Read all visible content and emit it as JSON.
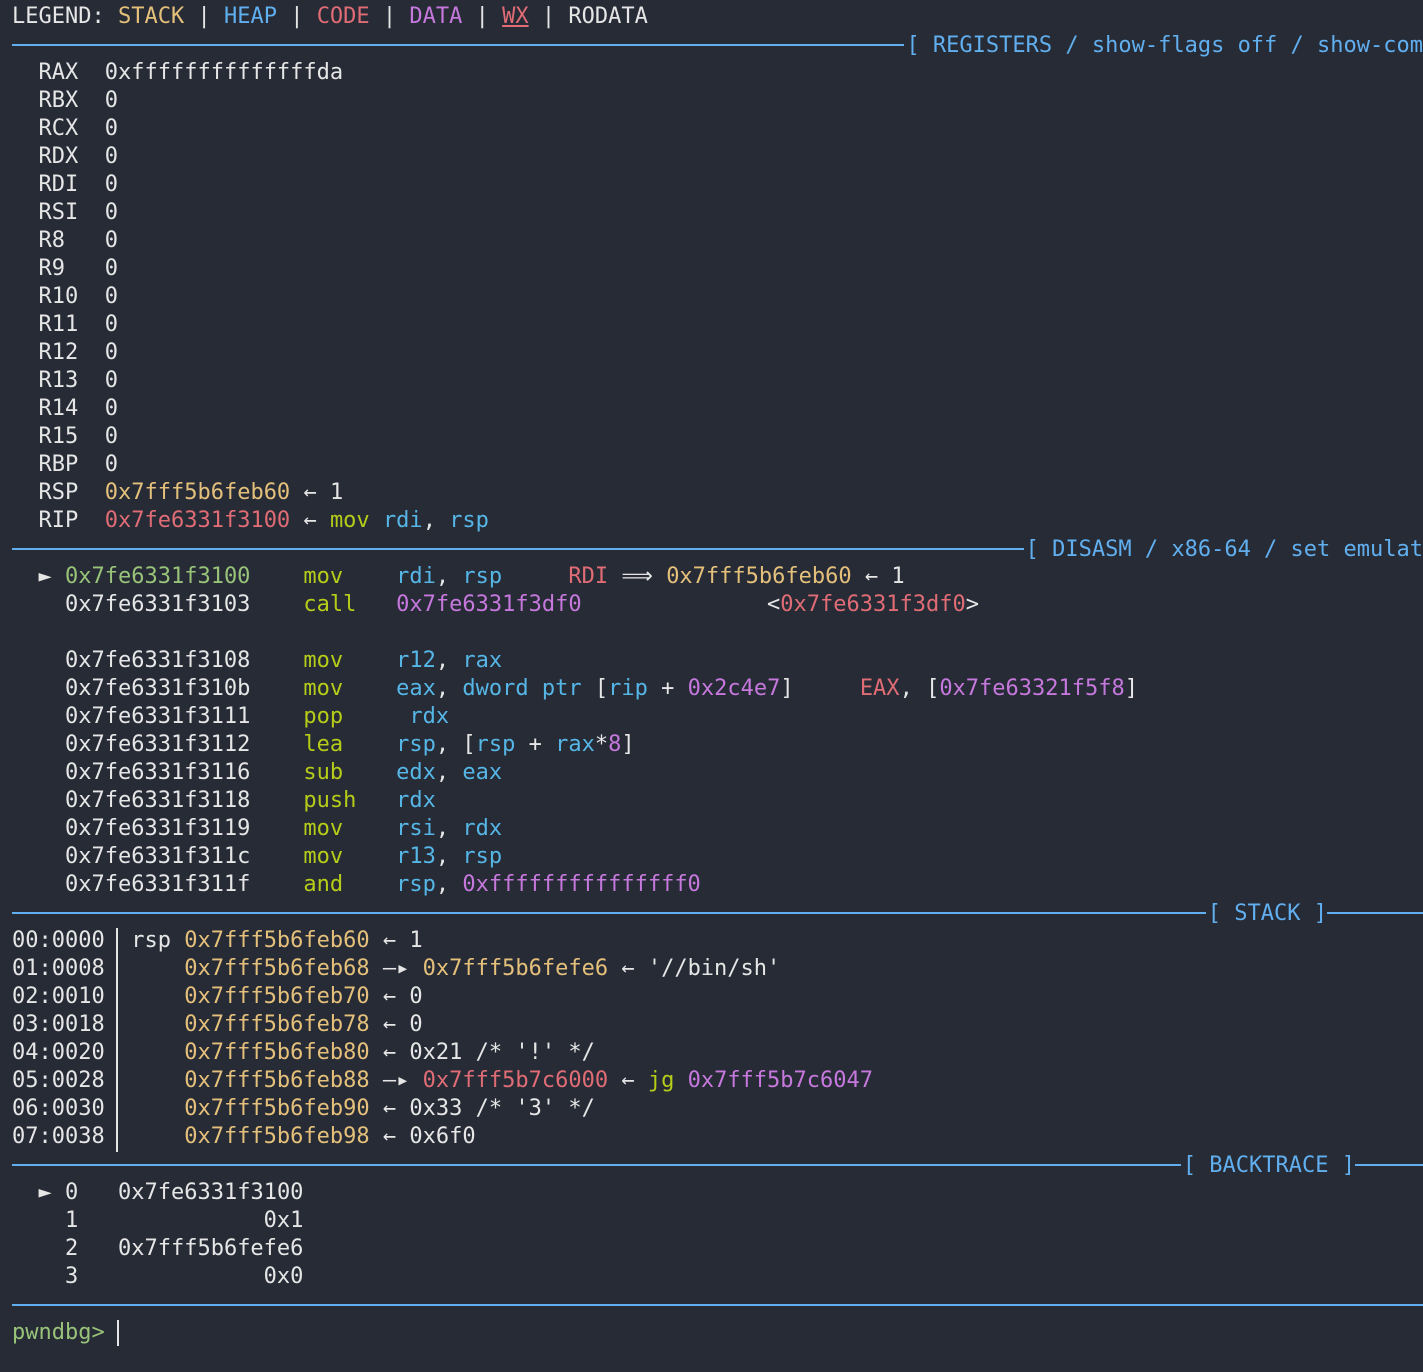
{
  "legend": {
    "label": "LEGEND:",
    "sep": "|",
    "stack": "STACK",
    "heap": "HEAP",
    "code": "CODE",
    "data": "DATA",
    "wx": "WX",
    "rodata": "RODATA"
  },
  "registers": {
    "title": "[ REGISTERS / show-flags off / show-com",
    "arrow": "←",
    "items": [
      {
        "name": "RAX",
        "value": "0xffffffffffffffda"
      },
      {
        "name": "RBX",
        "value": "0"
      },
      {
        "name": "RCX",
        "value": "0"
      },
      {
        "name": "RDX",
        "value": "0"
      },
      {
        "name": "RDI",
        "value": "0"
      },
      {
        "name": "RSI",
        "value": "0"
      },
      {
        "name": "R8",
        "value": "0"
      },
      {
        "name": "R9",
        "value": "0"
      },
      {
        "name": "R10",
        "value": "0"
      },
      {
        "name": "R11",
        "value": "0"
      },
      {
        "name": "R12",
        "value": "0"
      },
      {
        "name": "R13",
        "value": "0"
      },
      {
        "name": "R14",
        "value": "0"
      },
      {
        "name": "R15",
        "value": "0"
      },
      {
        "name": "RBP",
        "value": "0"
      }
    ],
    "rsp": {
      "name": "RSP",
      "value": "0x7fff5b6feb60",
      "deref": "1"
    },
    "rip": {
      "name": "RIP",
      "value": "0x7fe6331f3100",
      "mnemonic": "mov",
      "op1": "rdi",
      "comma": ",",
      "op2": "rsp"
    }
  },
  "disasm": {
    "title": "[ DISASM / x86-64 / set emulat",
    "cursor": "►",
    "rows": [
      {
        "addr": "0x7fe6331f3100",
        "mn": "mov",
        "a1": "rdi",
        "c": ",",
        "a2": "rsp",
        "note_reg": "RDI",
        "note_arrow": "⟹",
        "note_addr": "0x7fff5b6feb60",
        "note_larrow": "←",
        "note_val": "1"
      },
      {
        "addr": "0x7fe6331f3103",
        "mn": "call",
        "target": "0x7fe6331f3df0",
        "sym_open": "<",
        "sym": "0x7fe6331f3df0",
        "sym_close": ">"
      },
      {
        "addr": "0x7fe6331f3108",
        "mn": "mov",
        "a1": "r12",
        "c": ",",
        "a2": "rax"
      },
      {
        "addr": "0x7fe6331f310b",
        "mn": "mov",
        "a1": "eax",
        "c": ",",
        "p1": "dword ptr",
        "p2": "[",
        "p3": "rip",
        "p4": "+",
        "p5": "0x2c4e7",
        "p6": "]",
        "n1": "EAX",
        "n2": ",",
        "n3": "[",
        "n4": "0x7fe63321f5f8",
        "n5": "]"
      },
      {
        "addr": "0x7fe6331f3111",
        "mn": "pop",
        "a1": "rdx"
      },
      {
        "addr": "0x7fe6331f3112",
        "mn": "lea",
        "a1": "rsp",
        "c": ",",
        "b1": "[",
        "b2": "rsp",
        "b3": "+",
        "b4": "rax",
        "b5": "*",
        "b6": "8",
        "b7": "]"
      },
      {
        "addr": "0x7fe6331f3116",
        "mn": "sub",
        "a1": "edx",
        "c": ",",
        "a2": "eax"
      },
      {
        "addr": "0x7fe6331f3118",
        "mn": "push",
        "a1": "rdx"
      },
      {
        "addr": "0x7fe6331f3119",
        "mn": "mov",
        "a1": "rsi",
        "c": ",",
        "a2": "rdx"
      },
      {
        "addr": "0x7fe6331f311c",
        "mn": "mov",
        "a1": "r13",
        "c": ",",
        "a2": "rsp"
      },
      {
        "addr": "0x7fe6331f311f",
        "mn": "and",
        "a1": "rsp",
        "c": ",",
        "imm": "0xfffffffffffffff0"
      }
    ]
  },
  "stack": {
    "title": "[ STACK ]",
    "rsp_label": "rsp",
    "rows": [
      {
        "idx": "00:0000",
        "addr": "0x7fff5b6feb60",
        "arrow": "←",
        "val": "1"
      },
      {
        "idx": "01:0008",
        "addr": "0x7fff5b6feb68",
        "arrow": "—▸",
        "ptr": "0x7fff5b6fefe6",
        "arrow2": "←",
        "val": "'//bin/sh'"
      },
      {
        "idx": "02:0010",
        "addr": "0x7fff5b6feb70",
        "arrow": "←",
        "val": "0"
      },
      {
        "idx": "03:0018",
        "addr": "0x7fff5b6feb78",
        "arrow": "←",
        "val": "0"
      },
      {
        "idx": "04:0020",
        "addr": "0x7fff5b6feb80",
        "arrow": "←",
        "val": "0x21 /* '!' */"
      },
      {
        "idx": "05:0028",
        "addr": "0x7fff5b6feb88",
        "arrow": "—▸",
        "ptr": "0x7fff5b7c6000",
        "arrow2": "←",
        "mn": "jg",
        "target": "0x7fff5b7c6047"
      },
      {
        "idx": "06:0030",
        "addr": "0x7fff5b6feb90",
        "arrow": "←",
        "val": "0x33 /* '3' */"
      },
      {
        "idx": "07:0038",
        "addr": "0x7fff5b6feb98",
        "arrow": "←",
        "val": "0x6f0"
      }
    ]
  },
  "backtrace": {
    "title": "[ BACKTRACE ]",
    "cursor": "►",
    "rows": [
      {
        "n": "0",
        "addr": "0x7fe6331f3100"
      },
      {
        "n": "1",
        "addr": "0x1"
      },
      {
        "n": "2",
        "addr": "0x7fff5b6fefe6"
      },
      {
        "n": "3",
        "addr": "0x0"
      }
    ]
  },
  "prompt": "pwndbg>"
}
